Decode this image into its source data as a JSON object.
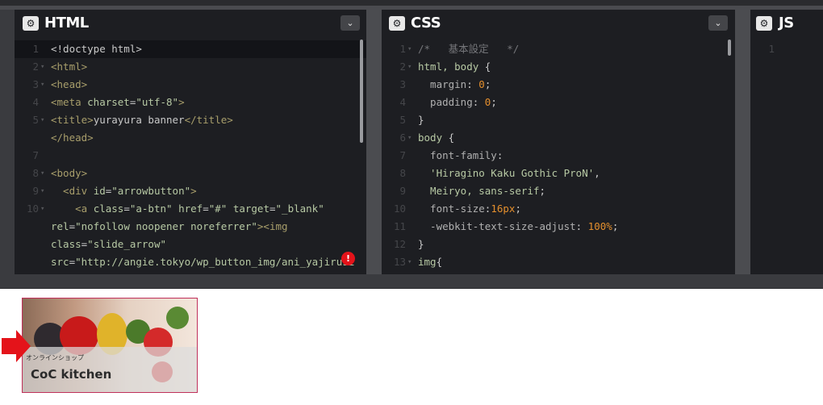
{
  "panels": {
    "html": {
      "title": "HTML",
      "gear_glyph": "⚙",
      "collapse_glyph": "⌄",
      "lines": [
        {
          "n": "1",
          "fold": "",
          "segs": [
            {
              "t": "<!doctype html>",
              "c": "plain"
            }
          ]
        },
        {
          "n": "2",
          "fold": "▾",
          "segs": [
            {
              "t": "<html>",
              "c": "tag"
            }
          ]
        },
        {
          "n": "3",
          "fold": "▾",
          "segs": [
            {
              "t": "<head>",
              "c": "tag"
            }
          ]
        },
        {
          "n": "4",
          "fold": "",
          "segs": [
            {
              "t": "<meta ",
              "c": "tag"
            },
            {
              "t": "charset",
              "c": "attr"
            },
            {
              "t": "=",
              "c": "plain"
            },
            {
              "t": "\"utf-8\"",
              "c": "str"
            },
            {
              "t": ">",
              "c": "tag"
            }
          ]
        },
        {
          "n": "5",
          "fold": "▾",
          "segs": [
            {
              "t": "<title>",
              "c": "tag"
            },
            {
              "t": "yurayura banner",
              "c": "plain"
            },
            {
              "t": "</title>",
              "c": "tag"
            }
          ]
        },
        {
          "n": "",
          "fold": "",
          "segs": [
            {
              "t": "</head>",
              "c": "tag"
            }
          ]
        },
        {
          "n": "7",
          "fold": "",
          "segs": []
        },
        {
          "n": "8",
          "fold": "▾",
          "segs": [
            {
              "t": "<body>",
              "c": "tag"
            }
          ]
        },
        {
          "n": "9",
          "fold": "▾",
          "segs": [
            {
              "t": "  <div ",
              "c": "tag"
            },
            {
              "t": "id",
              "c": "attr"
            },
            {
              "t": "=",
              "c": "plain"
            },
            {
              "t": "\"arrowbutton\"",
              "c": "str"
            },
            {
              "t": ">",
              "c": "tag"
            }
          ]
        },
        {
          "n": "10",
          "fold": "▾",
          "segs": [
            {
              "t": "    <a ",
              "c": "tag"
            },
            {
              "t": "class",
              "c": "attr"
            },
            {
              "t": "=",
              "c": "plain"
            },
            {
              "t": "\"a-btn\" ",
              "c": "str"
            },
            {
              "t": "href",
              "c": "attr"
            },
            {
              "t": "=",
              "c": "plain"
            },
            {
              "t": "\"#\" ",
              "c": "str"
            },
            {
              "t": "target",
              "c": "attr"
            },
            {
              "t": "=",
              "c": "plain"
            },
            {
              "t": "\"_blank\"",
              "c": "str"
            }
          ]
        },
        {
          "n": "",
          "fold": "",
          "segs": [
            {
              "t": "rel",
              "c": "attr"
            },
            {
              "t": "=",
              "c": "plain"
            },
            {
              "t": "\"nofollow noopener noreferrer\"",
              "c": "str"
            },
            {
              "t": "><img",
              "c": "tag"
            }
          ]
        },
        {
          "n": "",
          "fold": "",
          "segs": [
            {
              "t": "class",
              "c": "attr"
            },
            {
              "t": "=",
              "c": "plain"
            },
            {
              "t": "\"slide_arrow\"",
              "c": "str"
            }
          ]
        },
        {
          "n": "",
          "fold": "",
          "segs": [
            {
              "t": "src",
              "c": "attr"
            },
            {
              "t": "=",
              "c": "plain"
            },
            {
              "t": "\"http://angie.tokyo/wp_button_img/ani_yajirusi",
              "c": "str"
            }
          ]
        }
      ]
    },
    "css": {
      "title": "CSS",
      "gear_glyph": "⚙",
      "collapse_glyph": "⌄",
      "lines": [
        {
          "n": "1",
          "fold": "▾",
          "segs": [
            {
              "t": "/*   基本設定   */",
              "c": "comment"
            }
          ]
        },
        {
          "n": "2",
          "fold": "▾",
          "segs": [
            {
              "t": "html, body",
              "c": "sel"
            },
            {
              "t": " {",
              "c": "plain"
            }
          ]
        },
        {
          "n": "3",
          "fold": "",
          "segs": [
            {
              "t": "  margin",
              "c": "prop"
            },
            {
              "t": ": ",
              "c": "plain"
            },
            {
              "t": "0",
              "c": "num"
            },
            {
              "t": ";",
              "c": "plain"
            }
          ]
        },
        {
          "n": "4",
          "fold": "",
          "segs": [
            {
              "t": "  padding",
              "c": "prop"
            },
            {
              "t": ": ",
              "c": "plain"
            },
            {
              "t": "0",
              "c": "num"
            },
            {
              "t": ";",
              "c": "plain"
            }
          ]
        },
        {
          "n": "5",
          "fold": "",
          "segs": [
            {
              "t": "}",
              "c": "plain"
            }
          ]
        },
        {
          "n": "6",
          "fold": "▾",
          "segs": [
            {
              "t": "body",
              "c": "sel"
            },
            {
              "t": " {",
              "c": "plain"
            }
          ]
        },
        {
          "n": "7",
          "fold": "",
          "segs": [
            {
              "t": "  font-family",
              "c": "prop"
            },
            {
              "t": ":",
              "c": "plain"
            }
          ]
        },
        {
          "n": "8",
          "fold": "",
          "segs": [
            {
              "t": "  'Hiragino Kaku Gothic ProN'",
              "c": "str"
            },
            {
              "t": ",",
              "c": "plain"
            }
          ]
        },
        {
          "n": "9",
          "fold": "",
          "segs": [
            {
              "t": "  Meiryo, sans-serif",
              "c": "str"
            },
            {
              "t": ";",
              "c": "plain"
            }
          ]
        },
        {
          "n": "10",
          "fold": "",
          "segs": [
            {
              "t": "  font-size",
              "c": "prop"
            },
            {
              "t": ":",
              "c": "plain"
            },
            {
              "t": "16px",
              "c": "num"
            },
            {
              "t": ";",
              "c": "plain"
            }
          ]
        },
        {
          "n": "11",
          "fold": "",
          "segs": [
            {
              "t": "  -webkit-text-size-adjust",
              "c": "prop"
            },
            {
              "t": ": ",
              "c": "plain"
            },
            {
              "t": "100%",
              "c": "num"
            },
            {
              "t": ";",
              "c": "plain"
            }
          ]
        },
        {
          "n": "12",
          "fold": "",
          "segs": [
            {
              "t": "}",
              "c": "plain"
            }
          ]
        },
        {
          "n": "13",
          "fold": "▾",
          "segs": [
            {
              "t": "img",
              "c": "sel"
            },
            {
              "t": "{",
              "c": "plain"
            }
          ]
        }
      ]
    },
    "js": {
      "title": "JS",
      "gear_glyph": "⚙",
      "lines": [
        {
          "n": "1",
          "fold": "",
          "segs": []
        }
      ]
    }
  },
  "warning_glyph": "!",
  "preview": {
    "banner": {
      "shop_label": "オンラインショップ",
      "brand_name": "CoC kitchen"
    }
  },
  "colors": {
    "editor_bg": "#1d1e22",
    "chrome_bg": "#3a3b3f",
    "warning_red": "#e4131a",
    "arrow_red": "#e4131a",
    "banner_border": "#c0305a"
  }
}
